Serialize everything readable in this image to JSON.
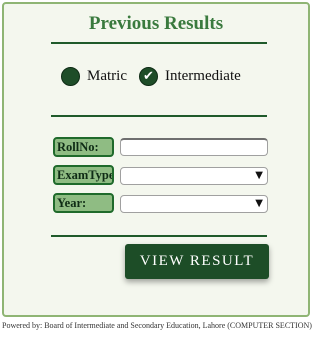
{
  "title": "Previous Results",
  "options": {
    "matric": "Matric",
    "intermediate": "Intermediate",
    "selected": "Intermediate"
  },
  "fields": {
    "rollno_label": "RollNo:",
    "examtype_label": "ExamType",
    "year_label": "Year:",
    "rollno_value": "",
    "examtype_value": "",
    "year_value": ""
  },
  "button": {
    "label": "VIEW RESULT"
  },
  "footer": {
    "text": "Powered by: Board of Intermediate and Secondary Education, Lahore (COMPUTER SECTION)"
  },
  "colors": {
    "primary": "#1d4d27",
    "title": "#3a7a3e",
    "label_bg": "#8fbc83",
    "panel_bg": "#f4f7ee",
    "panel_border": "#8fb574"
  }
}
